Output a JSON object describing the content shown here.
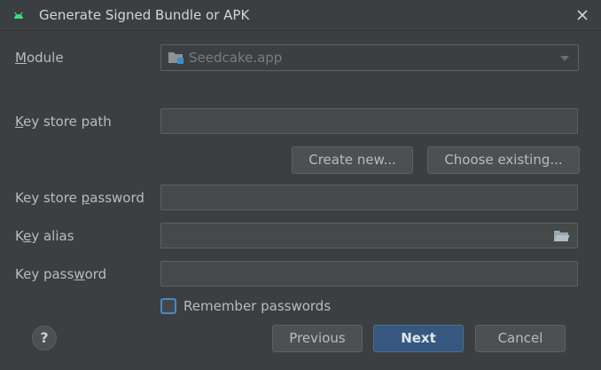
{
  "window": {
    "title": "Generate Signed Bundle or APK",
    "close_icon": "close-icon",
    "app_icon": "android-icon",
    "accent_color": "#3ddc84"
  },
  "module": {
    "label_mnemonic": "M",
    "label_rest": "odule",
    "value": "Seedcake.app",
    "icon": "module-folder-icon"
  },
  "key_store_path": {
    "label_mnemonic": "K",
    "label_rest": "ey store path",
    "value": ""
  },
  "buttons": {
    "create_new": "Create new...",
    "choose_existing": "Choose existing...",
    "previous": "Previous",
    "next": "Next",
    "cancel": "Cancel",
    "help": "?"
  },
  "key_store_password": {
    "label_before": "Key store ",
    "label_mnemonic": "p",
    "label_rest": "assword",
    "value": ""
  },
  "key_alias": {
    "label_before": "K",
    "label_mnemonic": "e",
    "label_rest": "y alias",
    "value": "",
    "icon": "folder-icon"
  },
  "key_password": {
    "label_before": "Key pass",
    "label_mnemonic": "w",
    "label_rest": "ord",
    "value": ""
  },
  "remember": {
    "label": "Remember passwords",
    "checked": false
  }
}
